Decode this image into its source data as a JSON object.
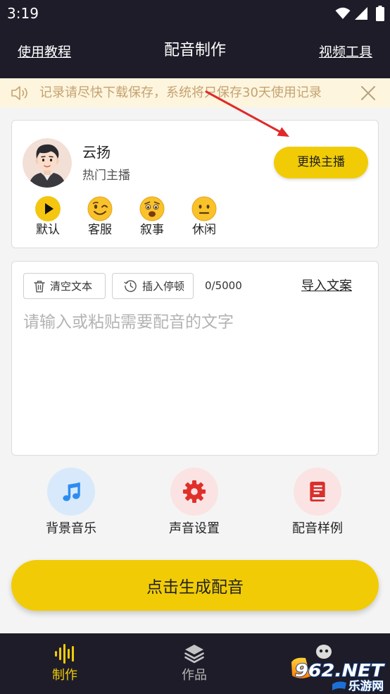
{
  "status_bar": {
    "time": "3:19",
    "icons": [
      "wifi-icon",
      "signal-icon",
      "battery-icon"
    ]
  },
  "header": {
    "left_link": "使用教程",
    "title": "配音制作",
    "right_link": "视频工具"
  },
  "notice": {
    "icon": "speaker-icon",
    "text": "记录请尽快下载保存，系统将只保存30天使用记录",
    "close_icon": "close-icon"
  },
  "anchor": {
    "name": "云扬",
    "tag": "热门主播",
    "change_button": "更换主播",
    "styles": [
      {
        "label": "默认",
        "icon": "play-icon"
      },
      {
        "label": "客服",
        "icon": "wink-emoji-icon"
      },
      {
        "label": "叙事",
        "icon": "worried-emoji-icon"
      },
      {
        "label": "休闲",
        "icon": "neutral-emoji-icon"
      }
    ]
  },
  "editor": {
    "clear_button": {
      "label": "清空文本",
      "icon": "trash-icon"
    },
    "pause_button": {
      "label": "插入停顿",
      "icon": "clock-icon"
    },
    "char_count": "0/5000",
    "import_link": "导入文案",
    "value": "",
    "placeholder": "请输入或粘贴需要配音的文字"
  },
  "tools": [
    {
      "label": "背景音乐",
      "icon": "music-note-icon"
    },
    {
      "label": "声音设置",
      "icon": "gear-icon"
    },
    {
      "label": "配音样例",
      "icon": "book-icon"
    }
  ],
  "generate_button": "点击生成配音",
  "bottom_nav": [
    {
      "label": "制作",
      "icon": "waveform-icon",
      "active": true
    },
    {
      "label": "作品",
      "icon": "layers-icon",
      "active": false
    },
    {
      "icon": "robot-head-icon",
      "active": false
    }
  ],
  "watermark": {
    "brand": "962.NET",
    "subtitle": "乐游网"
  },
  "colors": {
    "dark_bg": "#1e1c29",
    "page_bg": "#f4f4f4",
    "accent_yellow": "#f1cc06",
    "notice_bg": "#fdf5dd",
    "notice_text": "#c5a272",
    "nav_inactive": "#b5b5b5",
    "tool_blue": "#2d8cf0",
    "tool_red": "#e0302b"
  }
}
